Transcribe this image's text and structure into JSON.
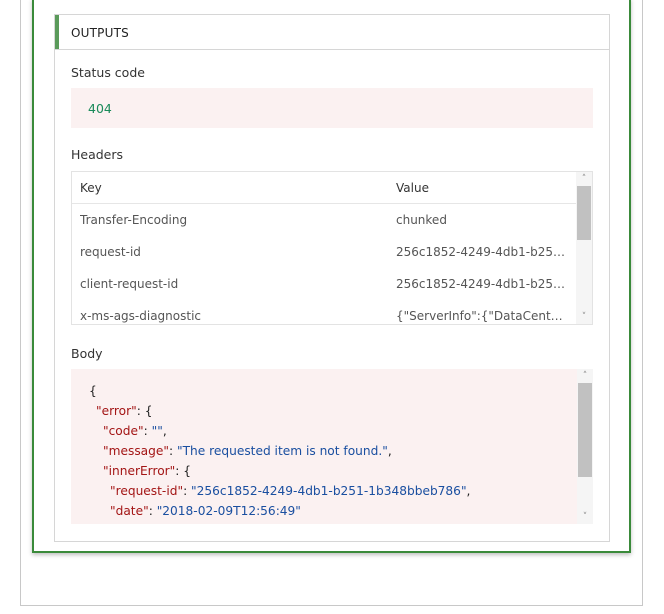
{
  "outputs": {
    "title": "OUTPUTS",
    "status": {
      "label": "Status code",
      "value": "404"
    },
    "headers": {
      "label": "Headers",
      "columns": [
        "Key",
        "Value"
      ],
      "rows": [
        {
          "key": "Transfer-Encoding",
          "value": "chunked"
        },
        {
          "key": "request-id",
          "value": "256c1852-4249-4db1-b251-1..."
        },
        {
          "key": "client-request-id",
          "value": "256c1852-4249-4db1-b251-1..."
        },
        {
          "key": "x-ms-ags-diagnostic",
          "value": "{\"ServerInfo\":{\"DataCenter\":\"W..."
        }
      ]
    },
    "body": {
      "label": "Body",
      "lines": [
        {
          "indent": 0,
          "parts": [
            {
              "t": "p",
              "v": "{"
            }
          ]
        },
        {
          "indent": 1,
          "parts": [
            {
              "t": "k",
              "v": "\"error\""
            },
            {
              "t": "p",
              "v": ": {"
            }
          ]
        },
        {
          "indent": 2,
          "parts": [
            {
              "t": "k",
              "v": "\"code\""
            },
            {
              "t": "p",
              "v": ": "
            },
            {
              "t": "s",
              "v": "\"\""
            },
            {
              "t": "p",
              "v": ","
            }
          ]
        },
        {
          "indent": 2,
          "parts": [
            {
              "t": "k",
              "v": "\"message\""
            },
            {
              "t": "p",
              "v": ": "
            },
            {
              "t": "s",
              "v": "\"The requested item is not found.\""
            },
            {
              "t": "p",
              "v": ","
            }
          ]
        },
        {
          "indent": 2,
          "parts": [
            {
              "t": "k",
              "v": "\"innerError\""
            },
            {
              "t": "p",
              "v": ": {"
            }
          ]
        },
        {
          "indent": 3,
          "parts": [
            {
              "t": "k",
              "v": "\"request-id\""
            },
            {
              "t": "p",
              "v": ": "
            },
            {
              "t": "s",
              "v": "\"256c1852-4249-4db1-b251-1b348bbeb786\""
            },
            {
              "t": "p",
              "v": ","
            }
          ]
        },
        {
          "indent": 3,
          "parts": [
            {
              "t": "k",
              "v": "\"date\""
            },
            {
              "t": "p",
              "v": ": "
            },
            {
              "t": "s",
              "v": "\"2018-02-09T12:56:49\""
            }
          ]
        }
      ]
    }
  },
  "icons": {
    "scroll_up": "chevron-up-icon",
    "scroll_down": "chevron-down-icon"
  }
}
